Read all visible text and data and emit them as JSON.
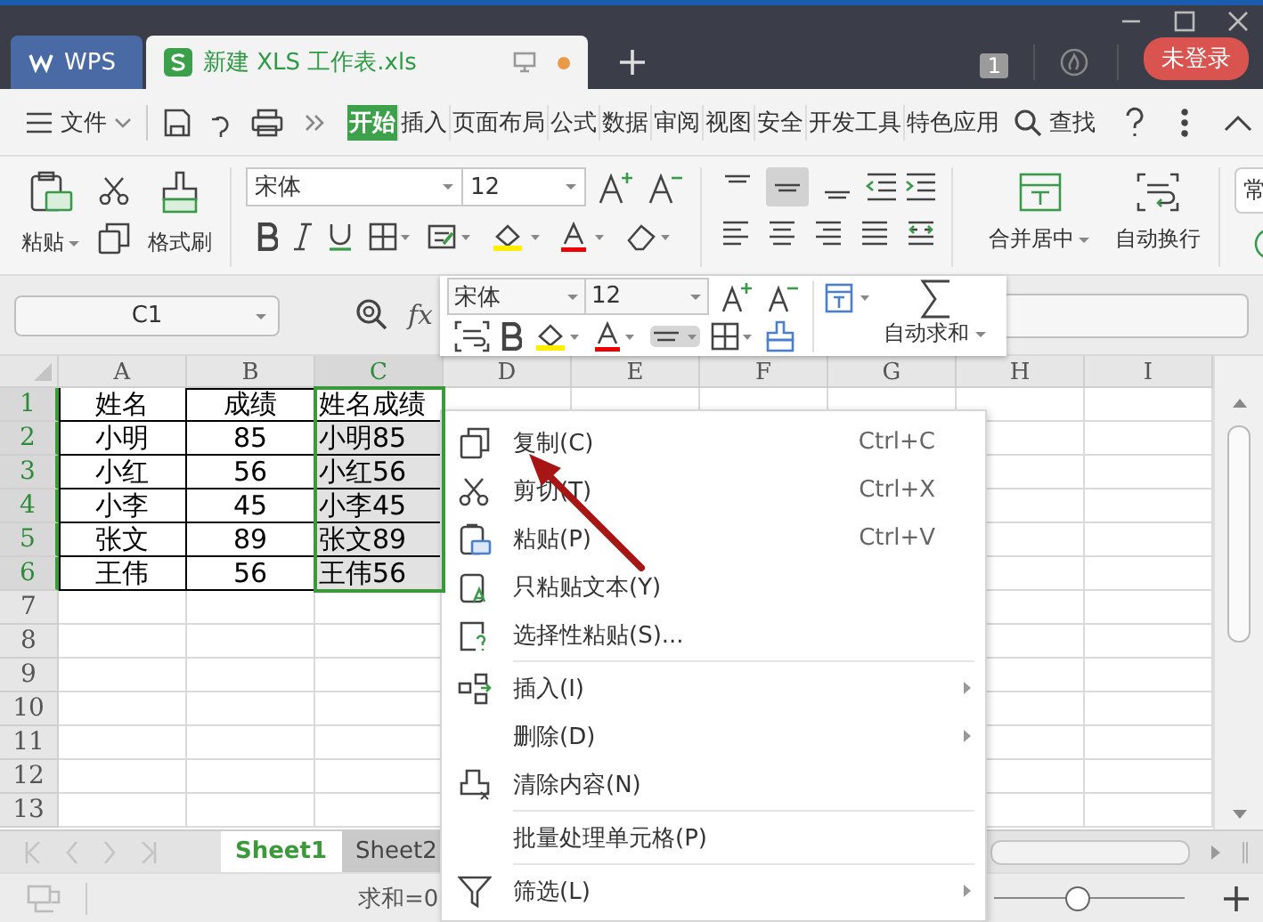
{
  "window": {
    "tabs": [
      {
        "label": "WPS",
        "kind": "app",
        "selected": false
      },
      {
        "label": "新建 XLS 工作表.xls",
        "kind": "document",
        "selected": true
      }
    ],
    "modified": true,
    "page_count": "1",
    "login": "未登录"
  },
  "menu_bar": {
    "file": "文件",
    "tabs": [
      {
        "label": "开始",
        "selected": true
      },
      {
        "label": "插入",
        "selected": false
      },
      {
        "label": "页面布局",
        "selected": false
      },
      {
        "label": "公式",
        "selected": false
      },
      {
        "label": "数据",
        "selected": false
      },
      {
        "label": "审阅",
        "selected": false
      },
      {
        "label": "视图",
        "selected": false
      },
      {
        "label": "安全",
        "selected": false
      },
      {
        "label": "开发工具",
        "selected": false
      },
      {
        "label": "特色应用",
        "selected": false
      }
    ],
    "search": "查找"
  },
  "ribbon": {
    "paste": "粘贴",
    "format_painter": "格式刷",
    "font": "宋体",
    "size": "12",
    "alignment": [
      {
        "selected": false
      },
      {
        "selected": true
      },
      {
        "selected": false
      }
    ],
    "merge": "合并居中",
    "wrap": "自动换行",
    "style_box": "常"
  },
  "formula_bar": {
    "cell_ref": "C1",
    "fx": "fx"
  },
  "sheet": {
    "columns": [
      {
        "label": "A",
        "selected": false
      },
      {
        "label": "B",
        "selected": false
      },
      {
        "label": "C",
        "selected": true
      },
      {
        "label": "D",
        "selected": false
      },
      {
        "label": "E",
        "selected": false
      },
      {
        "label": "F",
        "selected": false
      },
      {
        "label": "G",
        "selected": false
      },
      {
        "label": "H",
        "selected": false
      },
      {
        "label": "I",
        "selected": false
      }
    ],
    "rows": [
      {
        "label": "1",
        "selected": true,
        "cells": [
          "姓名",
          "成绩",
          "姓名成绩"
        ]
      },
      {
        "label": "2",
        "selected": true,
        "cells": [
          "小明",
          "85",
          "小明85"
        ]
      },
      {
        "label": "3",
        "selected": true,
        "cells": [
          "小红",
          "56",
          "小红56"
        ]
      },
      {
        "label": "4",
        "selected": true,
        "cells": [
          "小李",
          "45",
          "小李45"
        ]
      },
      {
        "label": "5",
        "selected": true,
        "cells": [
          "张文",
          "89",
          "张文89"
        ]
      },
      {
        "label": "6",
        "selected": true,
        "cells": [
          "王伟",
          "56",
          "王伟56"
        ]
      },
      {
        "label": "7",
        "selected": false
      },
      {
        "label": "8",
        "selected": false
      },
      {
        "label": "9",
        "selected": false
      },
      {
        "label": "10",
        "selected": false
      },
      {
        "label": "11",
        "selected": false
      },
      {
        "label": "12",
        "selected": false
      },
      {
        "label": "13",
        "selected": false
      }
    ]
  },
  "mini_toolbar": {
    "font": "宋体",
    "size": "12",
    "autosum": "自动求和",
    "align_pressed": true
  },
  "context_menu": {
    "items": [
      {
        "kind": "item",
        "label": "复制(C)",
        "shortcut": "Ctrl+C",
        "submenu": false
      },
      {
        "kind": "item",
        "label": "剪切(T)",
        "shortcut": "Ctrl+X",
        "submenu": false
      },
      {
        "kind": "item",
        "label": "粘贴(P)",
        "shortcut": "Ctrl+V",
        "submenu": false
      },
      {
        "kind": "item",
        "label": "只粘贴文本(Y)",
        "submenu": false
      },
      {
        "kind": "item",
        "label": "选择性粘贴(S)...",
        "submenu": false
      },
      {
        "kind": "separator"
      },
      {
        "kind": "item",
        "label": "插入(I)",
        "submenu": true
      },
      {
        "kind": "item",
        "label": "删除(D)",
        "submenu": true
      },
      {
        "kind": "item",
        "label": "清除内容(N)",
        "submenu": false
      },
      {
        "kind": "separator"
      },
      {
        "kind": "item",
        "label": "批量处理单元格(P)",
        "submenu": false
      },
      {
        "kind": "separator"
      },
      {
        "kind": "item",
        "label": "筛选(L)",
        "submenu": true
      }
    ]
  },
  "sheet_tabs": [
    {
      "label": "Sheet1",
      "selected": true
    },
    {
      "label": "Sheet2",
      "selected": false
    }
  ],
  "status_bar": {
    "sum": "求和=0",
    "zoom": {
      "level": 0.44
    }
  }
}
